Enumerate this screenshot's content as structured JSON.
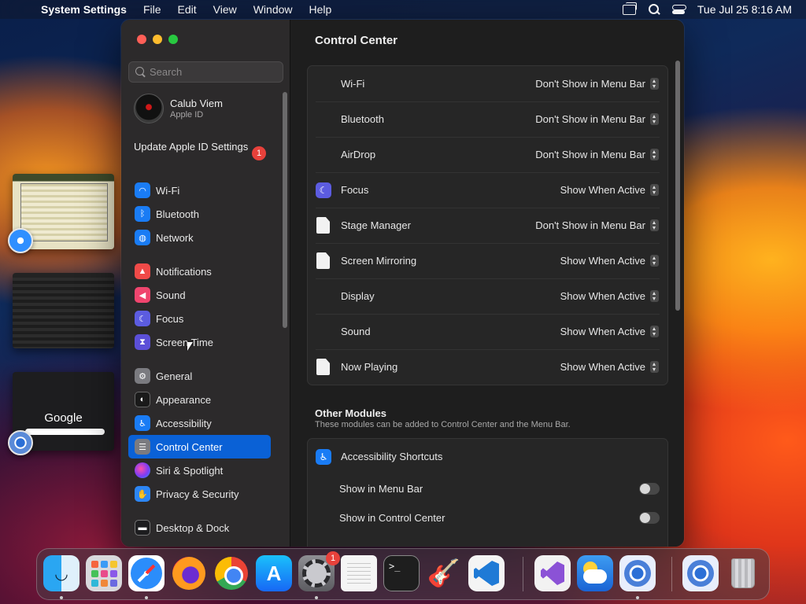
{
  "menubar": {
    "app": "System Settings",
    "items": [
      "File",
      "Edit",
      "View",
      "Window",
      "Help"
    ],
    "clock": "Tue Jul 25  8:16 AM"
  },
  "thumbnails": {
    "google_label": "Google"
  },
  "sidebar": {
    "search_placeholder": "Search",
    "user_name": "Calub Viem",
    "user_sub": "Apple ID",
    "update_label": "Update Apple ID Settings",
    "update_badge": "1",
    "items": [
      {
        "label": "Wi-Fi",
        "icon": "wifi-icon"
      },
      {
        "label": "Bluetooth",
        "icon": "bluetooth-icon"
      },
      {
        "label": "Network",
        "icon": "globe-icon"
      },
      {
        "label": "Notifications",
        "icon": "bell-icon"
      },
      {
        "label": "Sound",
        "icon": "speaker-icon"
      },
      {
        "label": "Focus",
        "icon": "moon-icon"
      },
      {
        "label": "Screen Time",
        "icon": "hourglass-icon"
      },
      {
        "label": "General",
        "icon": "gear-icon"
      },
      {
        "label": "Appearance",
        "icon": "appearance-icon"
      },
      {
        "label": "Accessibility",
        "icon": "accessibility-icon"
      },
      {
        "label": "Control Center",
        "icon": "control-center-icon"
      },
      {
        "label": "Siri & Spotlight",
        "icon": "siri-icon"
      },
      {
        "label": "Privacy & Security",
        "icon": "hand-icon"
      },
      {
        "label": "Desktop & Dock",
        "icon": "dock-icon"
      }
    ],
    "active": "Control Center"
  },
  "main": {
    "title": "Control Center",
    "modules": [
      {
        "label": "Wi-Fi",
        "value": "Don't Show in Menu Bar",
        "icon": "none"
      },
      {
        "label": "Bluetooth",
        "value": "Don't Show in Menu Bar",
        "icon": "none"
      },
      {
        "label": "AirDrop",
        "value": "Don't Show in Menu Bar",
        "icon": "none"
      },
      {
        "label": "Focus",
        "value": "Show When Active",
        "icon": "moon-icon"
      },
      {
        "label": "Stage Manager",
        "value": "Don't Show in Menu Bar",
        "icon": "document-icon"
      },
      {
        "label": "Screen Mirroring",
        "value": "Show When Active",
        "icon": "document-icon"
      },
      {
        "label": "Display",
        "value": "Show When Active",
        "icon": "none"
      },
      {
        "label": "Sound",
        "value": "Show When Active",
        "icon": "none"
      },
      {
        "label": "Now Playing",
        "value": "Show When Active",
        "icon": "document-icon"
      }
    ],
    "other_title": "Other Modules",
    "other_subtitle": "These modules can be added to Control Center and the Menu Bar.",
    "accessibility_shortcuts": {
      "label": "Accessibility Shortcuts",
      "show_menu_bar": "Show in Menu Bar",
      "show_menu_bar_on": false,
      "show_control_center": "Show in Control Center",
      "show_control_center_on": false
    }
  },
  "dock": {
    "apps": [
      "Finder",
      "Launchpad",
      "Safari",
      "Firefox",
      "Google Chrome",
      "App Store",
      "System Settings",
      "TextEdit",
      "Terminal",
      "GarageBand",
      "Visual Studio Code",
      "Visual Studio",
      "Weather",
      "Chromium",
      "Chromium",
      "Trash"
    ],
    "settings_badge": "1"
  }
}
